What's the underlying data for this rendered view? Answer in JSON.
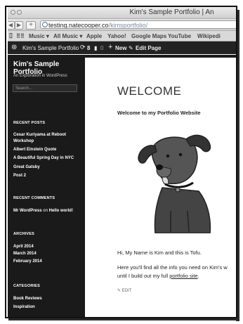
{
  "browser": {
    "window_title": "Kim's Sample Portfolio | An",
    "url_host": "testing.natecooper.co",
    "url_path": "/kimsportfolio/",
    "bookmarks": [
      "Music ▾",
      "All Music ▾",
      "Apple",
      "Yahoo!",
      "Google Maps",
      "YouTube",
      "Wikipedi"
    ]
  },
  "adminbar": {
    "site_name": "Kim's Sample Portfolio",
    "updates_count": "8",
    "comments_count": "0",
    "new_label": "New",
    "edit_label": "Edit Page"
  },
  "sidebar": {
    "site_title": "Kim's Sample Portfolio",
    "site_description": "An Exploration in WordPress",
    "search_placeholder": "Search...",
    "recent_posts_heading": "RECENT POSTS",
    "recent_posts": [
      "Cesar Kuriyama at Reboot",
      "Workshop",
      "Albert Einstein Quote",
      "A Beautiful Spring Day in NYC",
      "Great Gatsby",
      "Post 2"
    ],
    "recent_comments_heading": "RECENT COMMENTS",
    "comment_author": "Mr WordPress",
    "comment_on": "on",
    "comment_post": "Hello world!",
    "archives_heading": "ARCHIVES",
    "archives": [
      "April 2014",
      "March 2014",
      "February 2014"
    ],
    "categories_heading": "CATEGORIES",
    "categories": [
      "Book Reviews",
      "Inspiration"
    ]
  },
  "page": {
    "title": "WELCOME",
    "subtitle": "Welcome to my Portfolio Website",
    "intro": "Hi, My Name is Kim and this is Tofu.",
    "line2": "Here you'll find all the info you need on Kim's w",
    "line3_pre": "until I build out my full ",
    "line3_link": "portfolio site",
    "line3_post": ".",
    "edit_label": "EDIT"
  }
}
